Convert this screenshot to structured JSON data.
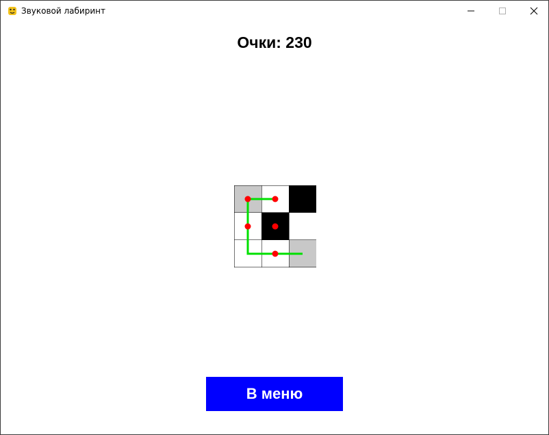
{
  "window": {
    "title": "Звуковой лабиринт",
    "app_icon": "snake-python-icon",
    "controls": [
      "minimize-icon",
      "maximize-icon",
      "close-icon"
    ]
  },
  "score": {
    "text": "Очки: 230"
  },
  "maze": {
    "rows": 3,
    "cols": 3,
    "cells": [
      [
        "visited",
        "open",
        "wall"
      ],
      [
        "open",
        "wall",
        "open"
      ],
      [
        "open",
        "open",
        "visited"
      ]
    ],
    "path": [
      [
        1,
        0
      ],
      [
        0,
        0
      ],
      [
        0,
        1
      ],
      [
        0,
        0
      ],
      [
        1,
        0
      ],
      [
        2,
        0
      ],
      [
        2,
        1
      ],
      [
        2,
        2
      ]
    ],
    "markers": [
      [
        0,
        0
      ],
      [
        0,
        1
      ],
      [
        1,
        0
      ],
      [
        1,
        1
      ],
      [
        2,
        1
      ]
    ],
    "colors": {
      "wall": "#000000",
      "visited": "#c8c8c8",
      "open": "#ffffff",
      "path": "#00e000",
      "marker": "#ff0000"
    }
  },
  "menu_button": {
    "label": "В меню",
    "color": "#0000ff"
  }
}
